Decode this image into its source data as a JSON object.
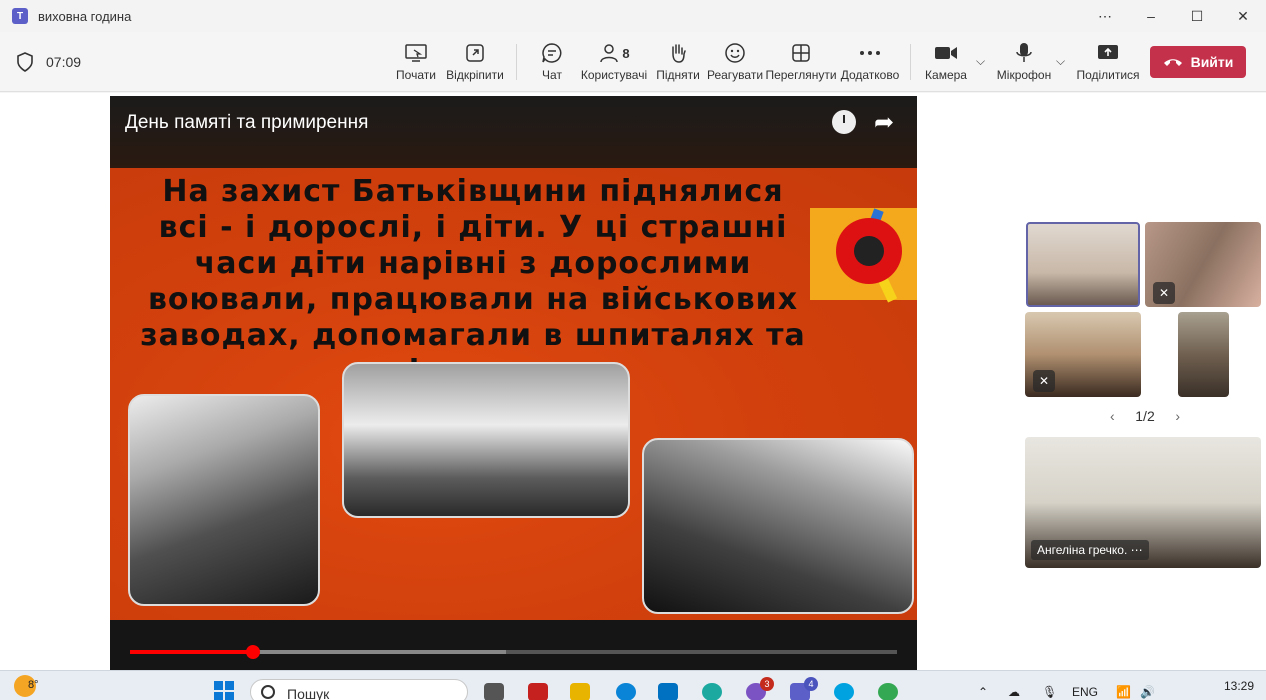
{
  "window": {
    "title": "виховна година",
    "controls": [
      "⋯",
      "–",
      "☐",
      "✕"
    ]
  },
  "meeting": {
    "timer": "07:09",
    "toolbar": {
      "start": "Почати",
      "popout": "Відкріпити",
      "chat": "Чат",
      "people": "Користувачі",
      "people_count": "8",
      "raise": "Підняти",
      "react": "Реагувати",
      "view": "Переглянути",
      "more": "Додатково",
      "camera": "Камера",
      "mic": "Мікрофон",
      "share": "Поділитися",
      "leave": "Вийти"
    }
  },
  "video": {
    "title": "День памяті та примирення",
    "slide_text": "На захист Батьківщини піднялися всі - і дорослі, і діти. У ці страшні часи діти нарівні з дорослими воювали, працювали на військових заводах, допомагали в шпиталях та лікарнях.",
    "progress": 0.16,
    "buffered": 0.49
  },
  "participants": {
    "pager": "1/2",
    "featured_name": "Ангеліна гречко."
  },
  "taskbar": {
    "weather_temp": "8°",
    "search_label": "Пошук",
    "viber_badge": "3",
    "teams_badge": "4",
    "lang": "ENG",
    "time": "13:29"
  },
  "colors": {
    "accent": "#6264a7",
    "leave": "#c4314b",
    "slide_bg": "#d4420d",
    "progress": "#ff0000"
  }
}
